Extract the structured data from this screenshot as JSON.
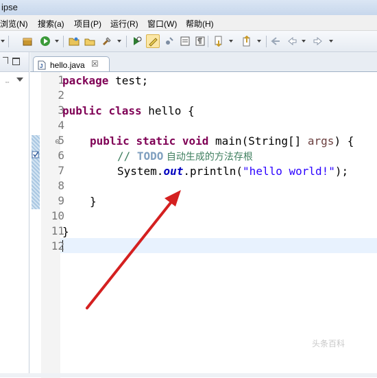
{
  "window": {
    "title": "ipse"
  },
  "menu": [
    {
      "label": "浏览(N)"
    },
    {
      "label": "搜索(a)"
    },
    {
      "label": "项目(P)"
    },
    {
      "label": "运行(R)"
    },
    {
      "label": "窗口(W)"
    },
    {
      "label": "帮助(H)"
    }
  ],
  "toolbar": {
    "icons": [
      "package-icon",
      "run-icon",
      "open-folder-icon",
      "open-type-icon",
      "search-icon",
      "next-annotation-icon",
      "toggle-mark-occurrences-icon",
      "edit-icon",
      "show-whitespace-icon",
      "pilcrow-icon",
      "next-edit-icon",
      "previous-edit-icon",
      "last-edit-icon",
      "back-icon",
      "forward-icon"
    ]
  },
  "editor": {
    "tab": {
      "filename": "hello.java",
      "close": "☒"
    },
    "line_numbers": [
      "1",
      "2",
      "3",
      "4",
      "5",
      "6",
      "7",
      "8",
      "9",
      "10",
      "11",
      "12"
    ],
    "code": {
      "l1_kw": "package",
      "l1_rest": " test;",
      "l3_kw1": "public",
      "l3_kw2": "class",
      "l3_rest": " hello {",
      "l5_kw1": "public",
      "l5_kw2": "static",
      "l5_kw3": "void",
      "l5_mid": " main(String[] ",
      "l5_param": "args",
      "l5_end": ") {",
      "l6_slashes": "// ",
      "l6_todo": "TODO",
      "l6_text": " 自动生成的方法存根",
      "l7_a": "System.",
      "l7_field": "out",
      "l7_b": ".println(",
      "l7_str": "\"hello world!\"",
      "l7_c": ");",
      "l9": "}",
      "l11": "}"
    }
  },
  "watermark": "头条百科",
  "colors": {
    "keyword": "#7f0055",
    "comment": "#3f7f5f",
    "string": "#2a00ff",
    "field": "#0000c0",
    "arrow": "#d42020"
  }
}
